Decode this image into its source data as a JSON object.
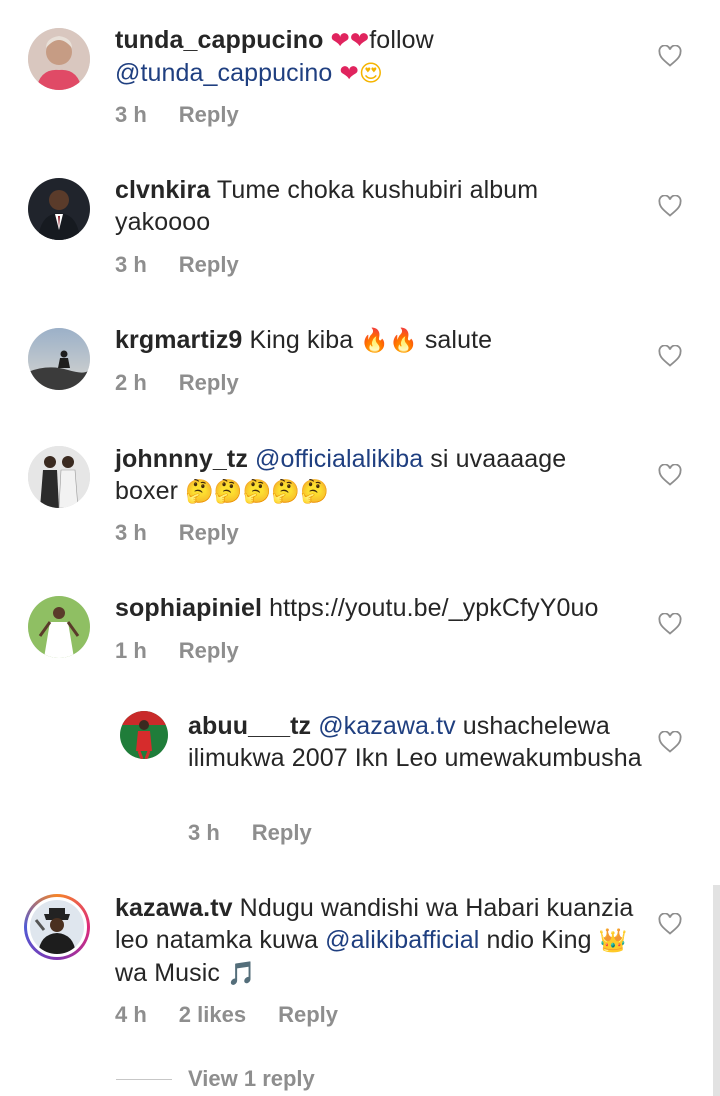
{
  "comments": [
    {
      "user": "tunda_cappucino",
      "text_segments": [
        {
          "t": " "
        },
        {
          "t": "❤❤",
          "emoji": "red-hearts"
        },
        {
          "t": "follow "
        },
        {
          "t": "@tunda_cappucino",
          "mention": true
        },
        {
          "t": " "
        },
        {
          "t": "❤",
          "emoji": "red-heart"
        },
        {
          "t": "😍",
          "emoji": "heart-eyes"
        }
      ],
      "time": "3 h",
      "likes": "",
      "reply": "Reply"
    },
    {
      "user": "clvnkira",
      "text_segments": [
        {
          "t": " Tume choka kushubiri album yakoooo"
        }
      ],
      "time": "3 h",
      "likes": "",
      "reply": "Reply"
    },
    {
      "user": "krgmartiz9",
      "text_segments": [
        {
          "t": " King kiba "
        },
        {
          "t": "🔥🔥",
          "emoji": "fire"
        },
        {
          "t": " salute"
        }
      ],
      "time": "2 h",
      "likes": "",
      "reply": "Reply"
    },
    {
      "user": "johnnny_tz",
      "text_segments": [
        {
          "t": " "
        },
        {
          "t": "@officialalikiba",
          "mention": true
        },
        {
          "t": "  si uvaaaage boxer "
        },
        {
          "t": "🤔🤔🤔🤔🤔",
          "emoji": "thinking-face"
        }
      ],
      "time": "3 h",
      "likes": "",
      "reply": "Reply"
    },
    {
      "user": "sophiapiniel",
      "text_segments": [
        {
          "t": " https://youtu.be/_ypkCfyY0uo"
        }
      ],
      "time": "1 h",
      "likes": "",
      "reply": "Reply"
    },
    {
      "user": "abuu___tz",
      "text_segments": [
        {
          "t": " "
        },
        {
          "t": "@kazawa.tv",
          "mention": true
        },
        {
          "t": " ushachelewa  ilimukwa 2007 Ikn Leo umewakumbusha"
        }
      ],
      "time": "3 h",
      "likes": "",
      "reply": "Reply"
    },
    {
      "user": "kazawa.tv",
      "text_segments": [
        {
          "t": " Ndugu wandishi wa Habari kuanzia leo natamka kuwa "
        },
        {
          "t": "@alikibafficial",
          "mention": true
        },
        {
          "t": " ndio King "
        },
        {
          "t": "👑",
          "emoji": "crown"
        },
        {
          "t": " wa Music "
        },
        {
          "t": "🎵",
          "emoji": "music-note"
        }
      ],
      "time": "4 h",
      "likes": "2 likes",
      "reply": "Reply"
    }
  ],
  "view_replies": "View 1 reply",
  "colors": {
    "mention": "#1f3f80",
    "meta": "#8e8e8e",
    "text": "#262626"
  }
}
